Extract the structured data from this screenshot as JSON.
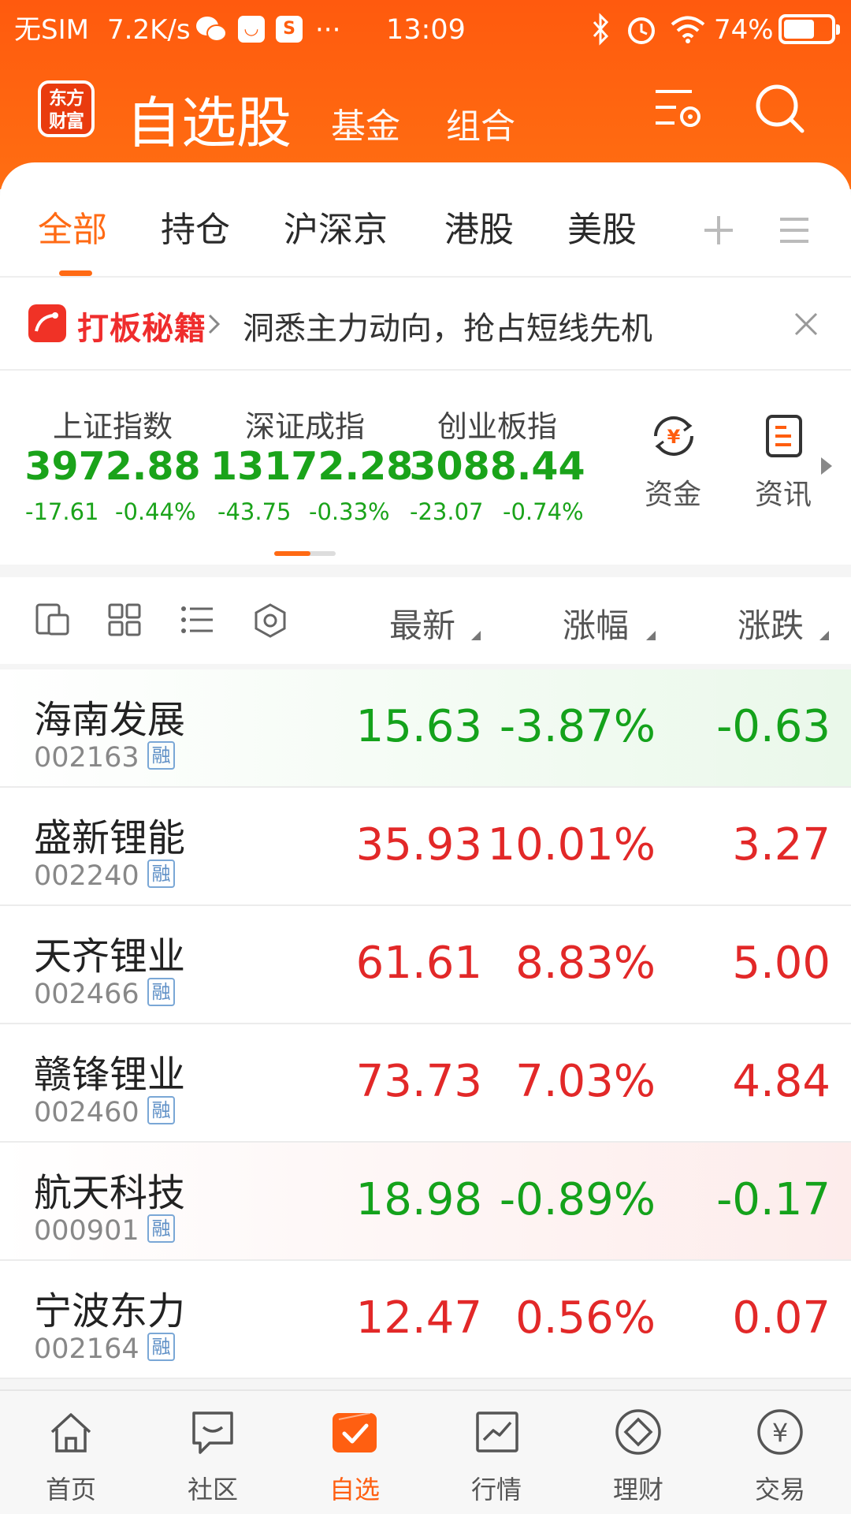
{
  "status_bar": {
    "carrier": "无SIM",
    "speed": "7.2K/s",
    "more": "···",
    "time": "13:09",
    "battery": "74%",
    "battery_level": 0.74
  },
  "header": {
    "logo_text_line1": "东方",
    "logo_text_line2": "财富",
    "title": "自选股",
    "tab_fund": "基金",
    "tab_portfolio": "组合"
  },
  "tabs": [
    {
      "label": "全部",
      "active": true
    },
    {
      "label": "持仓",
      "active": false
    },
    {
      "label": "沪深京",
      "active": false
    },
    {
      "label": "港股",
      "active": false
    },
    {
      "label": "美股",
      "active": false
    }
  ],
  "banner": {
    "title": "打板秘籍",
    "text": "洞悉主力动向，抢占短线先机"
  },
  "indices": [
    {
      "name": "上证指数",
      "value": "3972.88",
      "change": "-17.61",
      "percent": "-0.44%"
    },
    {
      "name": "深证成指",
      "value": "13172.28",
      "change": "-43.75",
      "percent": "-0.33%"
    },
    {
      "name": "创业板指",
      "value": "3088.44",
      "change": "-23.07",
      "percent": "-0.74%"
    }
  ],
  "side_links": {
    "funds": "资金",
    "news": "资讯"
  },
  "list_header": {
    "latest": "最新",
    "change_pct": "涨幅",
    "change": "涨跌"
  },
  "stocks": [
    {
      "name": "海南发展",
      "code": "002163",
      "tag": "融",
      "latest": "15.63",
      "pct": "-3.87%",
      "chg": "-0.63",
      "dir": "down"
    },
    {
      "name": "盛新锂能",
      "code": "002240",
      "tag": "融",
      "latest": "35.93",
      "pct": "10.01%",
      "chg": "3.27",
      "dir": "up"
    },
    {
      "name": "天齐锂业",
      "code": "002466",
      "tag": "融",
      "latest": "61.61",
      "pct": "8.83%",
      "chg": "5.00",
      "dir": "up"
    },
    {
      "name": "赣锋锂业",
      "code": "002460",
      "tag": "融",
      "latest": "73.73",
      "pct": "7.03%",
      "chg": "4.84",
      "dir": "up"
    },
    {
      "name": "航天科技",
      "code": "000901",
      "tag": "融",
      "latest": "18.98",
      "pct": "-0.89%",
      "chg": "-0.17",
      "dir": "down"
    },
    {
      "name": "宁波东力",
      "code": "002164",
      "tag": "融",
      "latest": "12.47",
      "pct": "0.56%",
      "chg": "0.07",
      "dir": "up"
    }
  ],
  "colors": {
    "brand_orange": "#ff6a14",
    "up_red": "#e22828",
    "down_green": "#14a21b"
  },
  "nav": [
    {
      "label": "首页",
      "icon": "home-icon",
      "active": false
    },
    {
      "label": "社区",
      "icon": "chat-bubble-icon",
      "active": false
    },
    {
      "label": "自选",
      "icon": "watchlist-check-icon",
      "active": true
    },
    {
      "label": "行情",
      "icon": "line-chart-icon",
      "active": false
    },
    {
      "label": "理财",
      "icon": "diamond-icon",
      "active": false
    },
    {
      "label": "交易",
      "icon": "yuan-coin-icon",
      "active": false
    }
  ]
}
